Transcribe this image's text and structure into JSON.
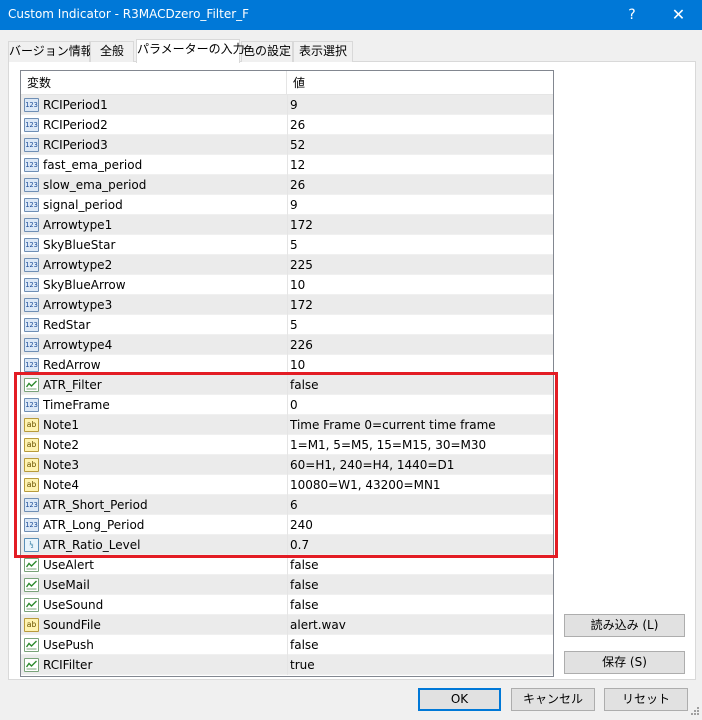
{
  "window": {
    "title": "Custom Indicator - R3MACDzero_Filter_F",
    "help_label": "?",
    "close_label": "✕"
  },
  "tabs": [
    {
      "label": "バージョン情報",
      "active": false
    },
    {
      "label": "全般",
      "active": false
    },
    {
      "label": "パラメーターの入力",
      "active": true
    },
    {
      "label": "色の設定",
      "active": false
    },
    {
      "label": "表示選択",
      "active": false
    }
  ],
  "grid": {
    "col_variable": "変数",
    "col_value": "値",
    "rows": [
      {
        "type": "num",
        "name": "RCIPeriod1",
        "value": "9"
      },
      {
        "type": "num",
        "name": "RCIPeriod2",
        "value": "26"
      },
      {
        "type": "num",
        "name": "RCIPeriod3",
        "value": "52"
      },
      {
        "type": "num",
        "name": "fast_ema_period",
        "value": "12"
      },
      {
        "type": "num",
        "name": "slow_ema_period",
        "value": "26"
      },
      {
        "type": "num",
        "name": "signal_period",
        "value": "9"
      },
      {
        "type": "num",
        "name": "Arrowtype1",
        "value": "172"
      },
      {
        "type": "num",
        "name": "SkyBlueStar",
        "value": "5"
      },
      {
        "type": "num",
        "name": "Arrowtype2",
        "value": "225"
      },
      {
        "type": "num",
        "name": "SkyBlueArrow",
        "value": "10"
      },
      {
        "type": "num",
        "name": "Arrowtype3",
        "value": "172"
      },
      {
        "type": "num",
        "name": "RedStar",
        "value": "5"
      },
      {
        "type": "num",
        "name": "Arrowtype4",
        "value": "226"
      },
      {
        "type": "num",
        "name": "RedArrow",
        "value": "10"
      },
      {
        "type": "bool",
        "name": "ATR_Filter",
        "value": "false"
      },
      {
        "type": "num",
        "name": "TimeFrame",
        "value": "0"
      },
      {
        "type": "str",
        "name": "Note1",
        "value": "Time Frame 0=current time frame"
      },
      {
        "type": "str",
        "name": "Note2",
        "value": "1=M1, 5=M5, 15=M15, 30=M30"
      },
      {
        "type": "str",
        "name": "Note3",
        "value": "60=H1, 240=H4, 1440=D1"
      },
      {
        "type": "str",
        "name": "Note4",
        "value": "10080=W1, 43200=MN1"
      },
      {
        "type": "num",
        "name": "ATR_Short_Period",
        "value": "6"
      },
      {
        "type": "num",
        "name": "ATR_Long_Period",
        "value": "240"
      },
      {
        "type": "dbl",
        "name": "ATR_Ratio_Level",
        "value": "0.7"
      },
      {
        "type": "bool",
        "name": "UseAlert",
        "value": "false"
      },
      {
        "type": "bool",
        "name": "UseMail",
        "value": "false"
      },
      {
        "type": "bool",
        "name": "UseSound",
        "value": "false"
      },
      {
        "type": "str",
        "name": "SoundFile",
        "value": "alert.wav"
      },
      {
        "type": "bool",
        "name": "UsePush",
        "value": "false"
      },
      {
        "type": "bool",
        "name": "RCIFilter",
        "value": "true"
      }
    ]
  },
  "icons": {
    "num": "123",
    "str": "ab",
    "dbl": "½"
  },
  "buttons": {
    "load": "読み込み (L)",
    "save": "保存 (S)",
    "ok": "OK",
    "cancel": "キャンセル",
    "reset": "リセット"
  },
  "colors": {
    "title_bar": "#0078d7",
    "highlight_box": "#e31c24"
  }
}
